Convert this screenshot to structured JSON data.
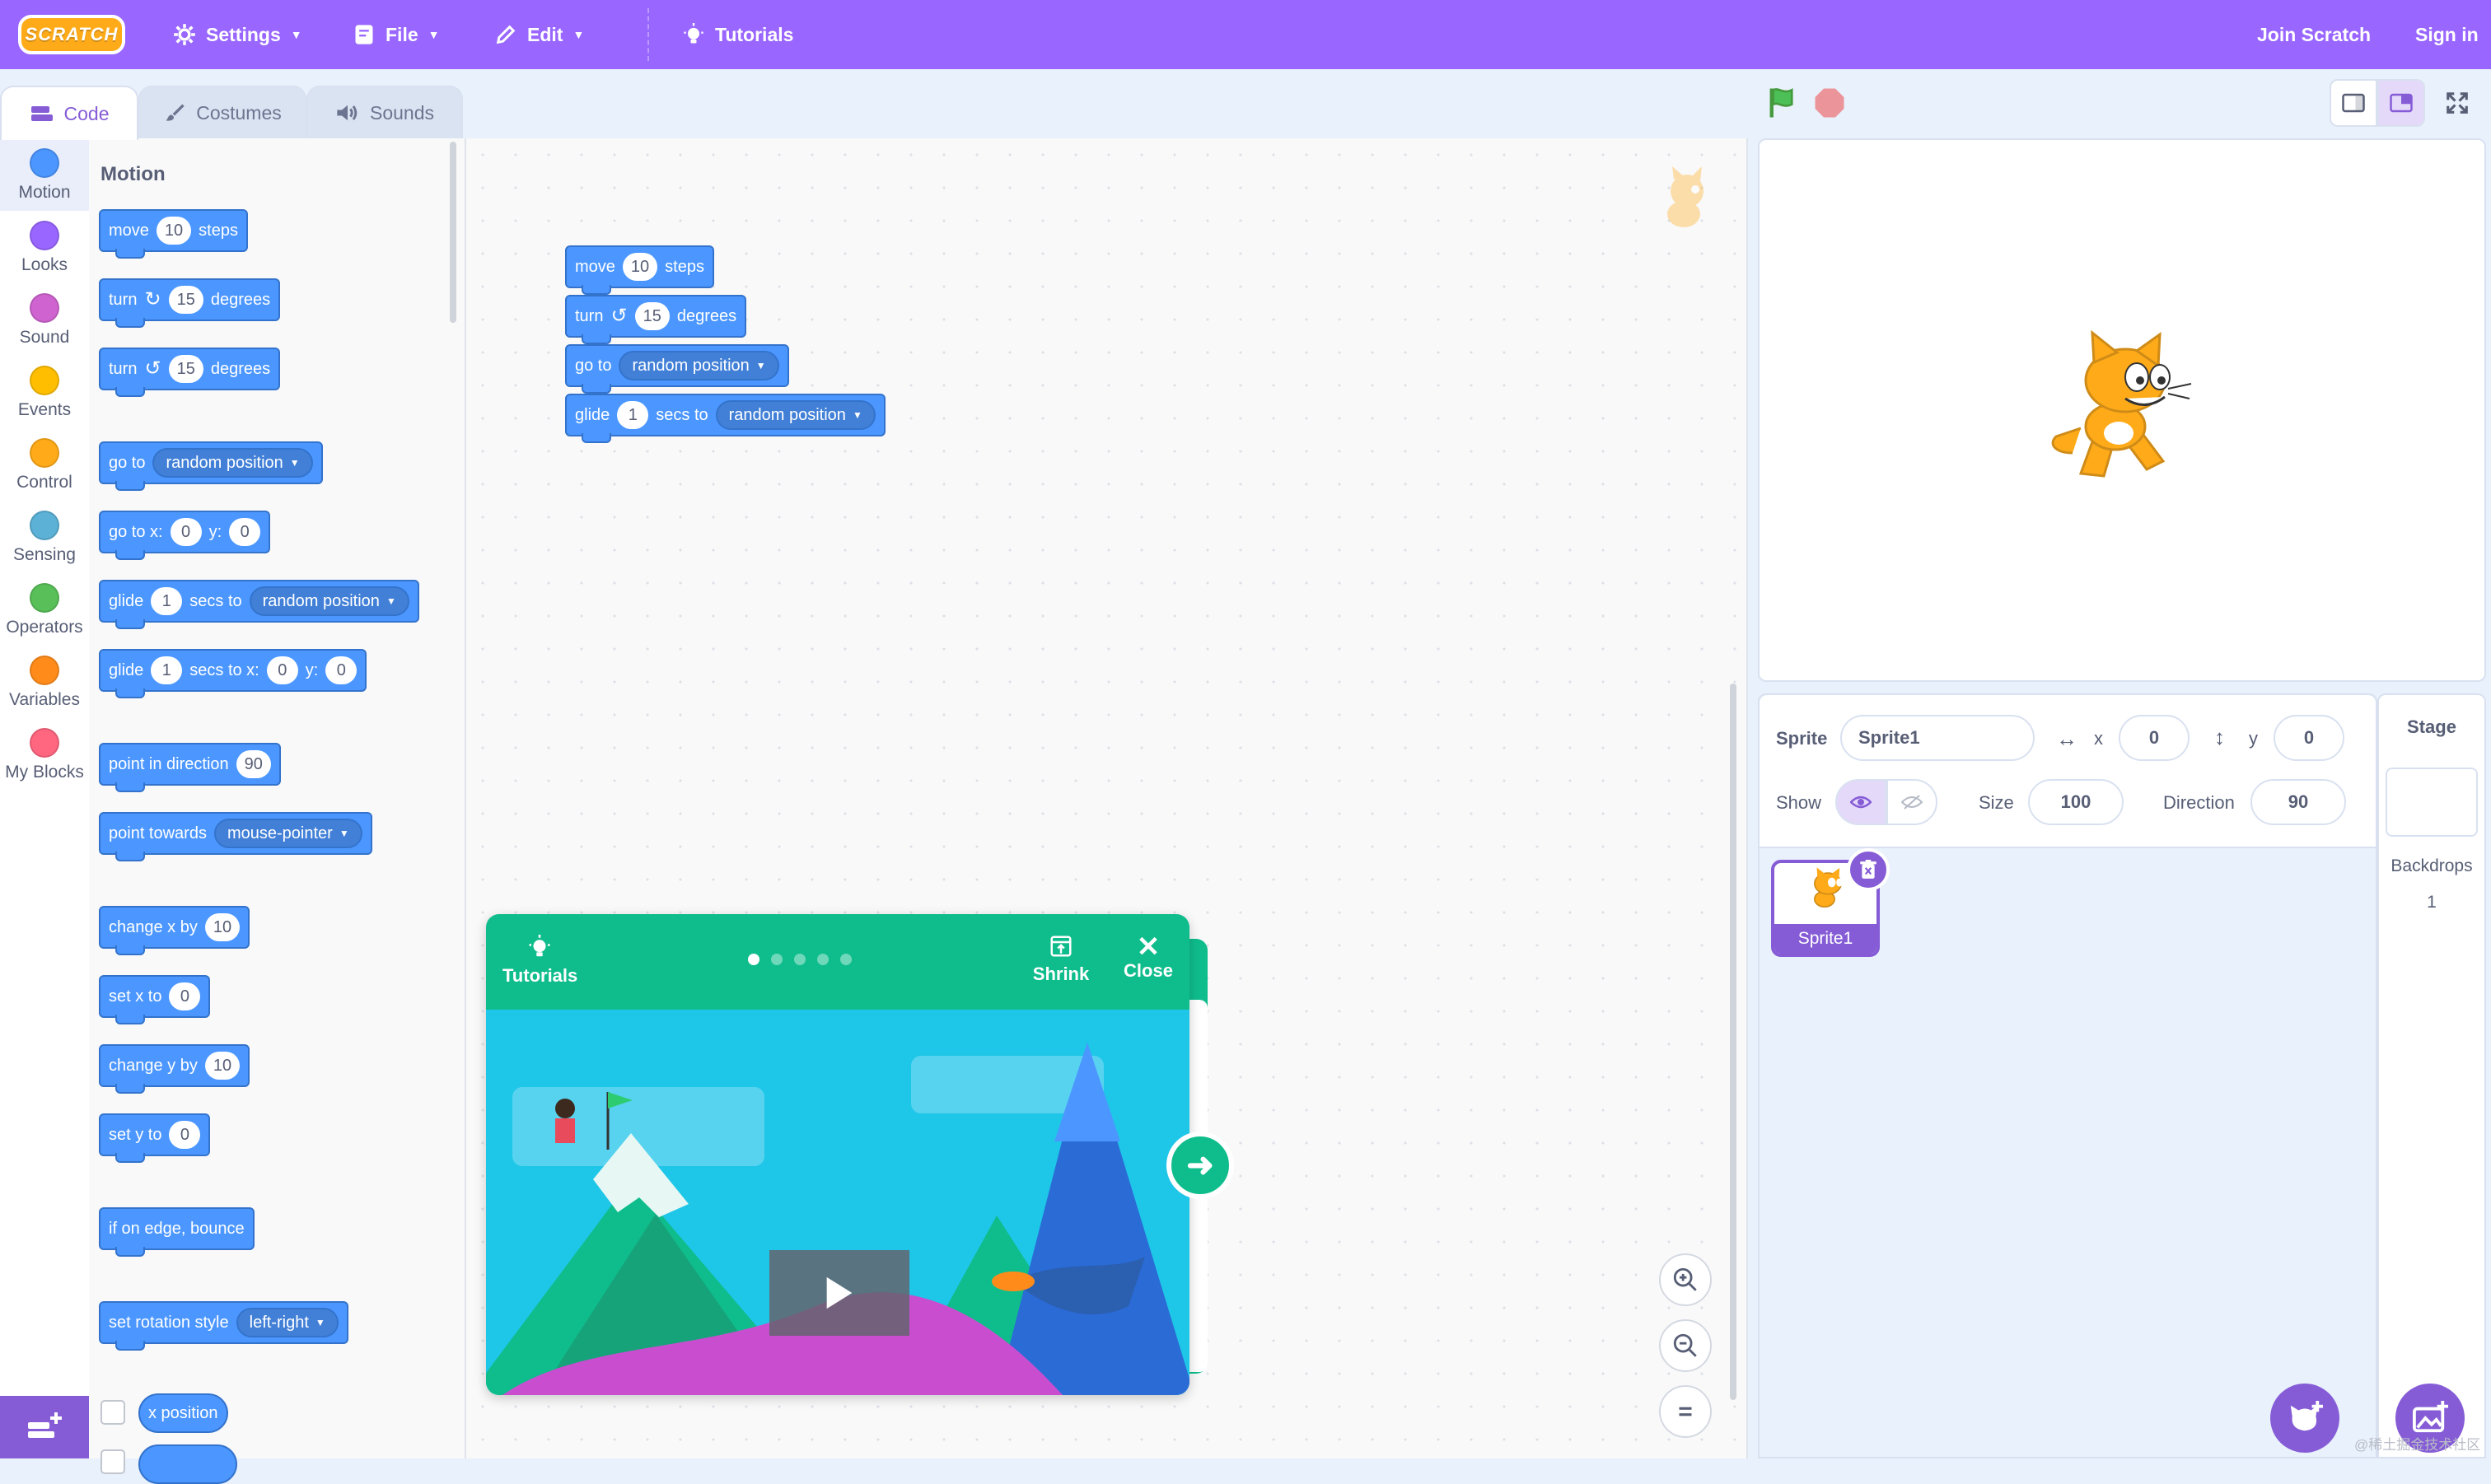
{
  "app": {
    "logo": "SCRATCH",
    "colors": {
      "accent": "#9966ff",
      "motion": "#4c97ff",
      "tutorial": "#0fbd8c"
    }
  },
  "menu": {
    "settings": "Settings",
    "file": "File",
    "edit": "Edit",
    "tutorials": "Tutorials",
    "join": "Join Scratch",
    "signin": "Sign in"
  },
  "tabs": {
    "code": "Code",
    "costumes": "Costumes",
    "sounds": "Sounds"
  },
  "categories": [
    {
      "label": "Motion",
      "color": "#4c97ff"
    },
    {
      "label": "Looks",
      "color": "#9966ff"
    },
    {
      "label": "Sound",
      "color": "#cf63cf"
    },
    {
      "label": "Events",
      "color": "#ffbf00"
    },
    {
      "label": "Control",
      "color": "#ffab19"
    },
    {
      "label": "Sensing",
      "color": "#5cb1d6"
    },
    {
      "label": "Operators",
      "color": "#59c059"
    },
    {
      "label": "Variables",
      "color": "#ff8c1a"
    },
    {
      "label": "My Blocks",
      "color": "#ff6680"
    }
  ],
  "palette": {
    "title": "Motion",
    "move": {
      "a": "move",
      "v": "10",
      "b": "steps"
    },
    "turn_right": {
      "a": "turn",
      "v": "15",
      "b": "degrees"
    },
    "turn_left": {
      "a": "turn",
      "v": "15",
      "b": "degrees"
    },
    "goto": {
      "a": "go to",
      "d": "random position"
    },
    "goto_xy": {
      "a": "go to x:",
      "x": "0",
      "b": "y:",
      "y": "0"
    },
    "glide_to": {
      "a": "glide",
      "v": "1",
      "b": "secs to",
      "d": "random position"
    },
    "glide_xy": {
      "a": "glide",
      "v": "1",
      "b": "secs to x:",
      "x": "0",
      "c": "y:",
      "y": "0"
    },
    "point_dir": {
      "a": "point in direction",
      "v": "90"
    },
    "point_towards": {
      "a": "point towards",
      "d": "mouse-pointer"
    },
    "change_x": {
      "a": "change x by",
      "v": "10"
    },
    "set_x": {
      "a": "set x to",
      "v": "0"
    },
    "change_y": {
      "a": "change y by",
      "v": "10"
    },
    "set_y": {
      "a": "set y to",
      "v": "0"
    },
    "bounce": {
      "a": "if on edge, bounce"
    },
    "rot_style": {
      "a": "set rotation style",
      "d": "left-right"
    },
    "x_position": {
      "a": "x position"
    }
  },
  "script": {
    "move": {
      "a": "move",
      "v": "10",
      "b": "steps"
    },
    "turn": {
      "a": "turn",
      "v": "15",
      "b": "degrees"
    },
    "goto": {
      "a": "go to",
      "d": "random position"
    },
    "glide": {
      "a": "glide",
      "v": "1",
      "b": "secs to",
      "d": "random position"
    }
  },
  "tutorial_card": {
    "label": "Tutorials",
    "shrink": "Shrink",
    "close": "Close",
    "steps": 5,
    "current_step": 1
  },
  "sprite_info": {
    "sprite_label": "Sprite",
    "sprite_name": "Sprite1",
    "x_label": "x",
    "x": "0",
    "y_label": "y",
    "y": "0",
    "show_label": "Show",
    "size_label": "Size",
    "size": "100",
    "direction_label": "Direction",
    "direction": "90"
  },
  "sprites": [
    {
      "name": "Sprite1"
    }
  ],
  "stage_pane": {
    "title": "Stage",
    "backdrops_label": "Backdrops",
    "backdrops_count": "1"
  },
  "watermark": "@稀土掘金技术社区"
}
